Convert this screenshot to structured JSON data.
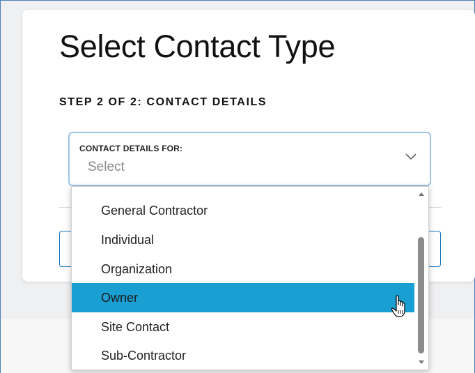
{
  "dialog": {
    "title": "Select Contact Type",
    "step": "STEP 2 OF 2: CONTACT DETAILS"
  },
  "contact_select": {
    "label": "CONTACT DETAILS FOR:",
    "value": "Select",
    "icon": "chevron-down-icon"
  },
  "dropdown": {
    "options": [
      {
        "label": "General Contractor"
      },
      {
        "label": "Individual"
      },
      {
        "label": "Organization"
      },
      {
        "label": "Owner",
        "highlighted": true
      },
      {
        "label": "Site Contact"
      },
      {
        "label": "Sub-Contractor"
      }
    ],
    "highlight_color": "#1a9fd3"
  },
  "colors": {
    "accent": "#1a73b8",
    "focus_border": "#9dc4ea"
  }
}
